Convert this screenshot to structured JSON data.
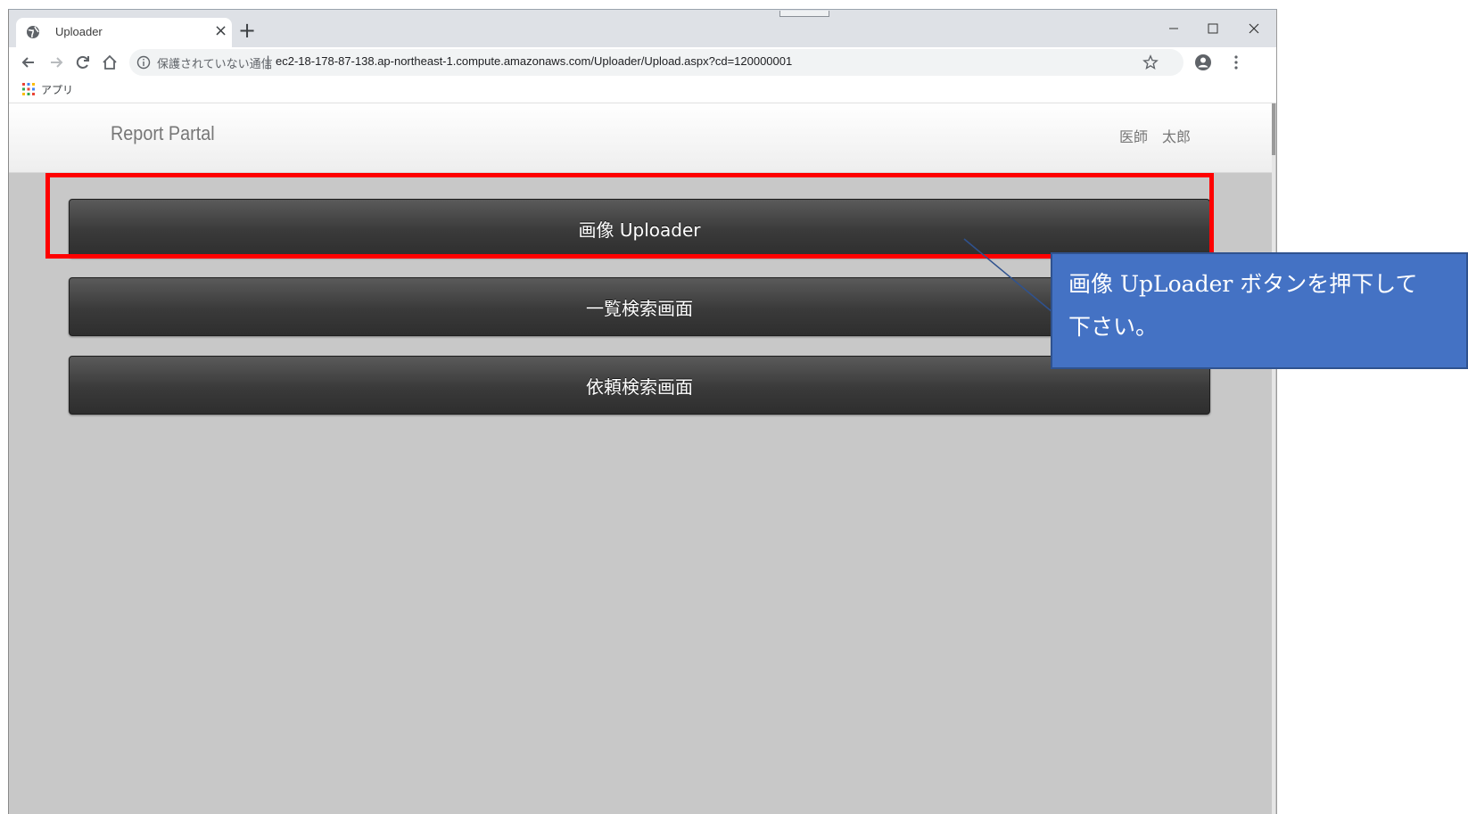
{
  "browser": {
    "tab": {
      "title": "Uploader",
      "close": "×"
    },
    "new_tab": "+",
    "omnibox": {
      "security_text": "保護されていない通信",
      "separator": "|",
      "url": "ec2-18-178-87-138.ap-northeast-1.compute.amazonaws.com/Uploader/Upload.aspx?cd=120000001"
    },
    "bookmarks": {
      "apps_label": "アプリ"
    }
  },
  "site": {
    "brand": "Report Partal",
    "user": "医師　太郎"
  },
  "menu": {
    "buttons": [
      {
        "label": "画像 Uploader"
      },
      {
        "label": "一覧検索画面"
      },
      {
        "label": "依頼検索画面"
      }
    ]
  },
  "annotation": {
    "callout_line1": "画像 UpLoader ボタンを押下して",
    "callout_line2": "下さい。",
    "highlight_color": "#ff0000",
    "callout_color": "#4472c4"
  }
}
